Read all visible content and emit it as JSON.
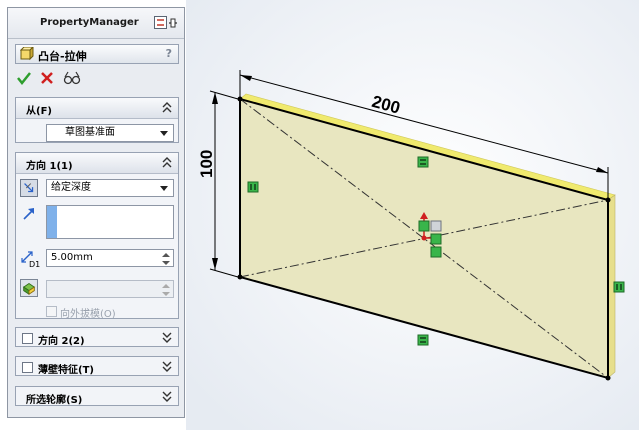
{
  "property_manager": {
    "title": "PropertyManager",
    "feature": {
      "title": "凸台-拉伸",
      "help": "?"
    },
    "actions": {
      "ok": "ok-check-icon",
      "cancel": "cancel-x-icon",
      "preview": "detailed-preview-icon"
    },
    "from": {
      "label": "从(F)",
      "start_condition": "草图基准面"
    },
    "direction1": {
      "label": "方向 1(1)",
      "end_condition": "给定深度",
      "depth_value": "5.00mm",
      "depth_label": "D1",
      "draft_outward_label": "向外拔模(O)"
    },
    "direction2": {
      "label": "方向 2(2)"
    },
    "thin_feature": {
      "label": "薄壁特征(T)"
    },
    "selected_contours": {
      "label": "所选轮廓(S)"
    }
  },
  "sketch": {
    "dimensions": {
      "width": "200",
      "height": "100"
    },
    "colors": {
      "face": "#e8e6c0",
      "edge": "#000000",
      "relation_marker": "#39b54a",
      "highlight_edge": "#f0ea6e"
    }
  }
}
